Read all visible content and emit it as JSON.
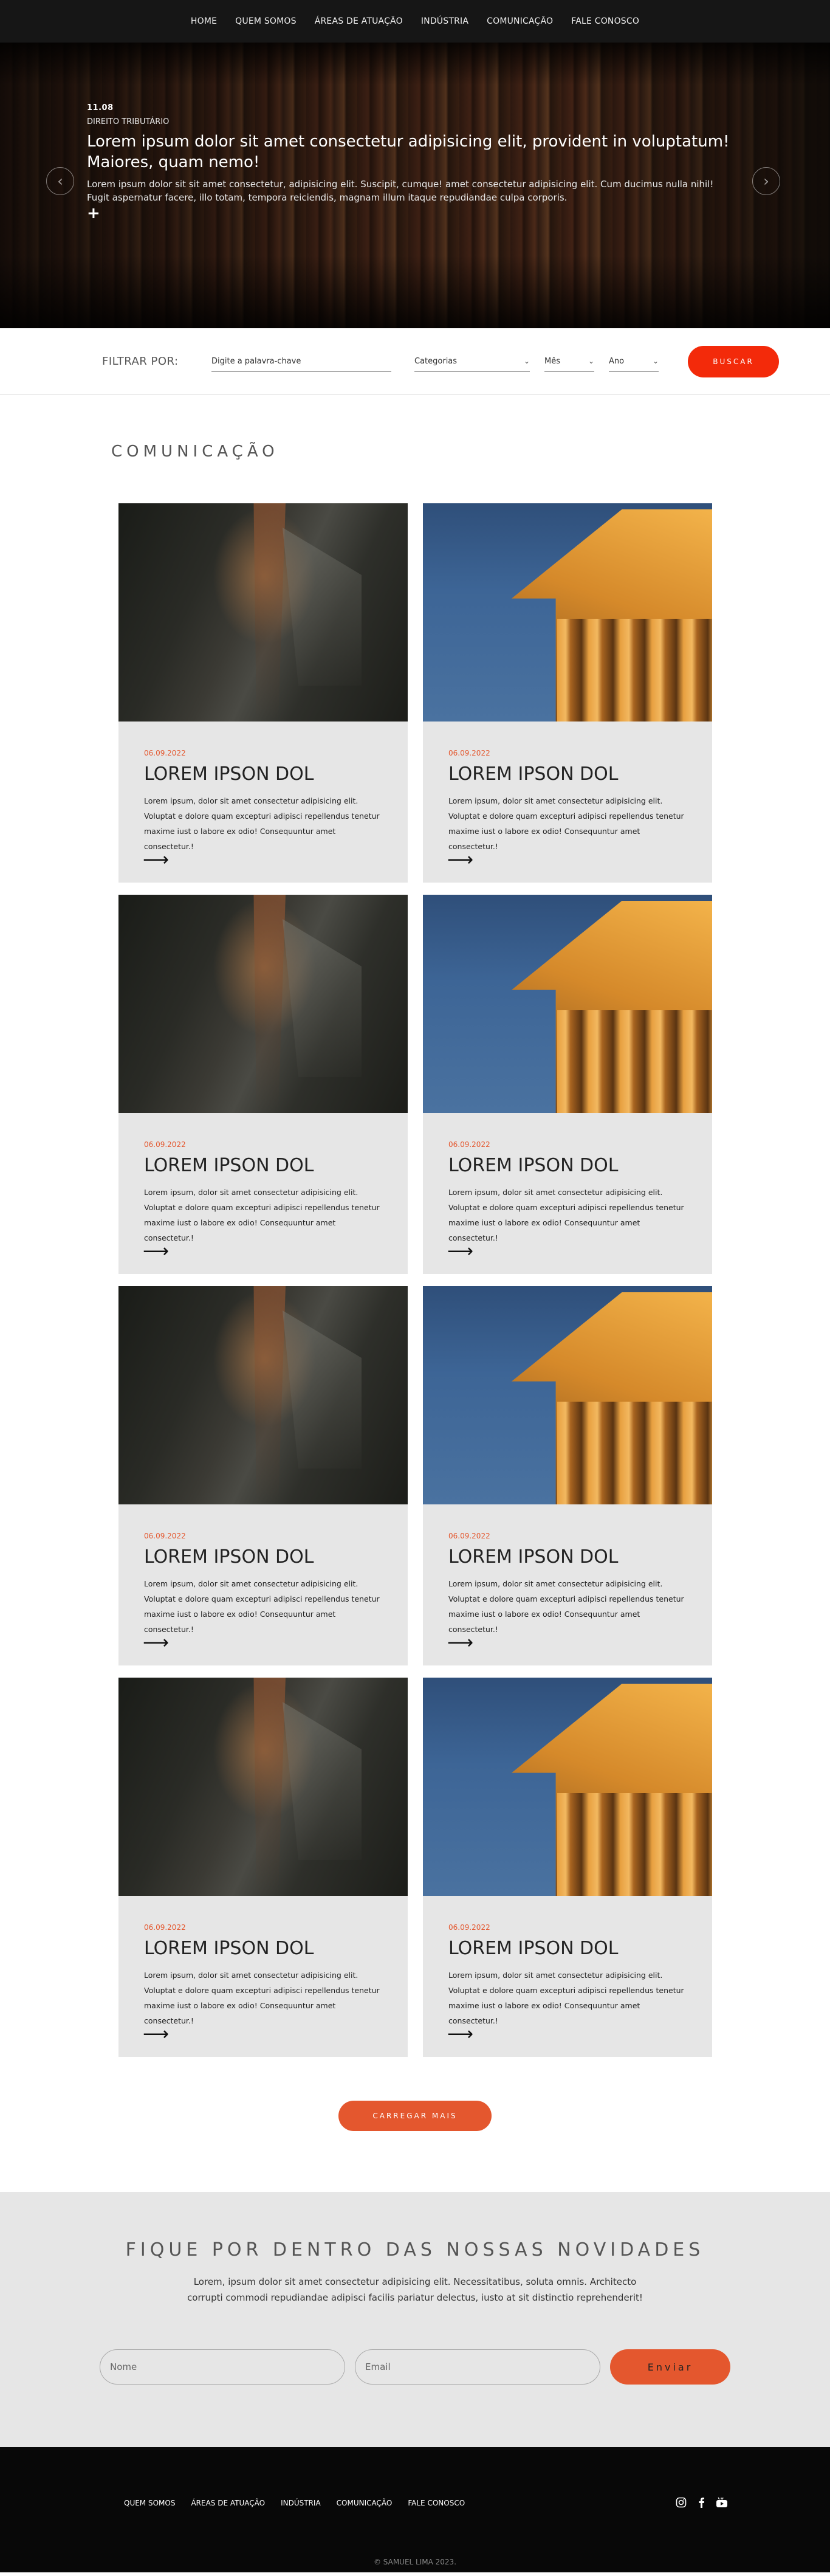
{
  "nav": {
    "items": [
      "HOME",
      "QUEM SOMOS",
      "ÁREAS DE ATUAÇÃO",
      "INDÚSTRIA",
      "COMUNICAÇÃO",
      "FALE CONOSCO"
    ]
  },
  "hero": {
    "date": "11.08",
    "category": "DIREITO TRIBUTÁRIO",
    "title": "Lorem ipsum dolor sit amet consectetur adipisicing elit, provident in voluptatum! Maiores, quam nemo!",
    "text": "Lorem ipsum dolor sit sit amet consectetur, adipisicing elit. Suscipit, cumque! amet consectetur adipisicing elit. Cum ducimus nulla nihil! Fugit aspernatur facere, illo totam, tempora reiciendis, magnam illum itaque repudiandae culpa corporis.",
    "plus": "+",
    "prev_icon": "‹",
    "next_icon": "›"
  },
  "filter": {
    "label": "FILTRAR POR:",
    "search_placeholder": "Digite a palavra-chave",
    "category": "Categorias",
    "month": "Mês",
    "year": "Ano",
    "button": "BUSCAR"
  },
  "section": {
    "title": "COMUNICAÇÃO"
  },
  "cards": [
    {
      "image": "suit",
      "date": "06.09.2022",
      "title": "LOREM IPSON DOL",
      "text": "Lorem ipsum, dolor sit amet consectetur adipisicing elit. Voluptat e dolore quam excepturi adipisci repellendus tenetur maxime iust o labore ex odio! Consequuntur amet consectetur.!"
    },
    {
      "image": "court",
      "date": "06.09.2022",
      "title": "LOREM IPSON DOL",
      "text": "Lorem ipsum, dolor sit amet consectetur adipisicing elit. Voluptat e dolore quam excepturi adipisci repellendus tenetur maxime iust o labore ex odio! Consequuntur amet consectetur.!"
    },
    {
      "image": "suit",
      "date": "06.09.2022",
      "title": "LOREM IPSON DOL",
      "text": "Lorem ipsum, dolor sit amet consectetur adipisicing elit. Voluptat e dolore quam excepturi adipisci repellendus tenetur maxime iust o labore ex odio! Consequuntur amet consectetur.!"
    },
    {
      "image": "court",
      "date": "06.09.2022",
      "title": "LOREM IPSON DOL",
      "text": "Lorem ipsum, dolor sit amet consectetur adipisicing elit. Voluptat e dolore quam excepturi adipisci repellendus tenetur maxime iust o labore ex odio! Consequuntur amet consectetur.!"
    },
    {
      "image": "suit",
      "date": "06.09.2022",
      "title": "LOREM IPSON DOL",
      "text": "Lorem ipsum, dolor sit amet consectetur adipisicing elit. Voluptat e dolore quam excepturi adipisci repellendus tenetur maxime iust o labore ex odio! Consequuntur amet consectetur.!"
    },
    {
      "image": "court",
      "date": "06.09.2022",
      "title": "LOREM IPSON DOL",
      "text": "Lorem ipsum, dolor sit amet consectetur adipisicing elit. Voluptat e dolore quam excepturi adipisci repellendus tenetur maxime iust o labore ex odio! Consequuntur amet consectetur.!"
    },
    {
      "image": "suit",
      "date": "06.09.2022",
      "title": "LOREM IPSON DOL",
      "text": "Lorem ipsum, dolor sit amet consectetur adipisicing elit. Voluptat e dolore quam excepturi adipisci repellendus tenetur maxime iust o labore ex odio! Consequuntur amet consectetur.!"
    },
    {
      "image": "court",
      "date": "06.09.2022",
      "title": "LOREM IPSON DOL",
      "text": "Lorem ipsum, dolor sit amet consectetur adipisicing elit. Voluptat e dolore quam excepturi adipisci repellendus tenetur maxime iust o labore ex odio! Consequuntur amet consectetur.!"
    }
  ],
  "card_arrow": "⟶",
  "load_more": "CARREGAR MAIS",
  "newsletter": {
    "title": "FIQUE POR DENTRO DAS NOSSAS NOVIDADES",
    "text": "Lorem, ipsum dolor sit amet consectetur adipisicing elit. Necessitatibus, soluta omnis. Architecto corrupti commodi repudiandae adipisci facilis pariatur delectus, iusto at sit distinctio reprehenderit!",
    "name_placeholder": "Nome",
    "email_placeholder": "Email",
    "button": "Enviar"
  },
  "footer": {
    "items": [
      "QUEM SOMOS",
      "ÁREAS DE ATUAÇÃO",
      "INDÚSTRIA",
      "COMUNICAÇÃO",
      "FALE CONOSCO"
    ],
    "social_icons": [
      "instagram-icon",
      "facebook-icon",
      "youtube-icon"
    ],
    "copyright": "© SAMUEL LIMA 2023."
  },
  "colors": {
    "accent": "#e4572e",
    "search_button": "#f32a0a",
    "nav_bg": "#161616",
    "footer_bg": "#080808",
    "card_bg": "#e6e6e6"
  }
}
